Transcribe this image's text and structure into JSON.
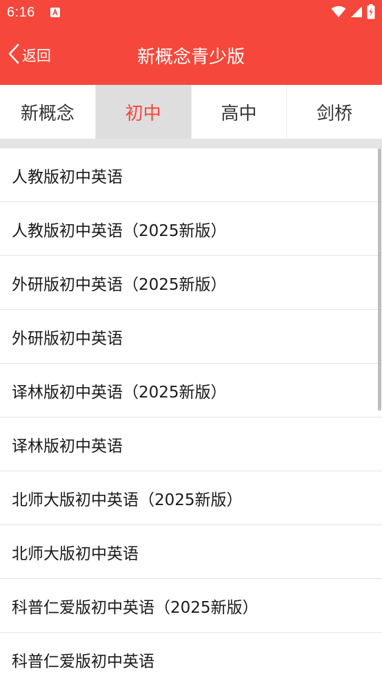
{
  "status_bar": {
    "time": "6:16"
  },
  "toolbar": {
    "back_label": "返回",
    "title": "新概念青少版"
  },
  "tabs": [
    {
      "label": "新概念",
      "active": false
    },
    {
      "label": "初中",
      "active": true
    },
    {
      "label": "高中",
      "active": false
    },
    {
      "label": "剑桥",
      "active": false
    }
  ],
  "list": {
    "items": [
      "人教版初中英语",
      "人教版初中英语（2025新版）",
      "外研版初中英语（2025新版）",
      "外研版初中英语",
      "译林版初中英语（2025新版）",
      "译林版初中英语",
      "北师大版初中英语（2025新版）",
      "北师大版初中英语",
      "科普仁爱版初中英语（2025新版）",
      "科普仁爱版初中英语"
    ]
  },
  "colors": {
    "accent": "#f5473b",
    "active_tab_bg": "#dedede"
  }
}
